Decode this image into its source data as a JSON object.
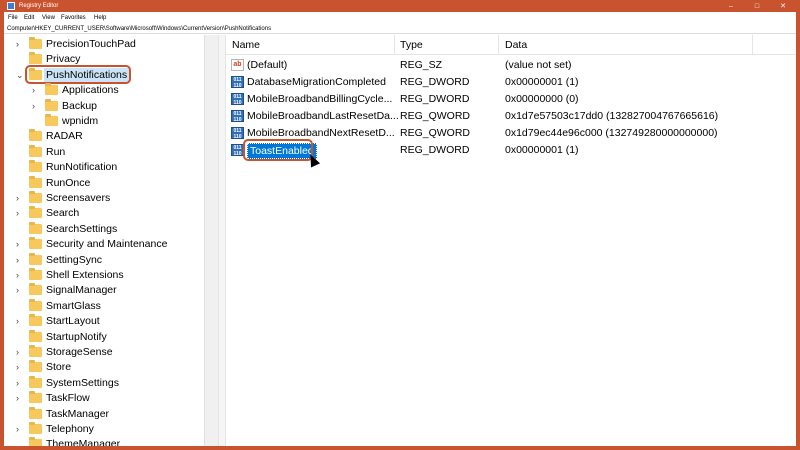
{
  "window": {
    "title": "Registry Editor",
    "controls": {
      "minimize": "–",
      "maximize": "□",
      "close": "✕"
    }
  },
  "menu": [
    "File",
    "Edit",
    "View",
    "Favorites",
    "Help"
  ],
  "address": "Computer\\HKEY_CURRENT_USER\\Software\\Microsoft\\Windows\\CurrentVersion\\PushNotifications",
  "tree": [
    {
      "label": "PrecisionTouchPad",
      "expandable": true,
      "indent": 0
    },
    {
      "label": "Privacy",
      "expandable": false,
      "indent": 0
    },
    {
      "label": "PushNotifications",
      "expandable": true,
      "expanded": true,
      "indent": 0,
      "selected": true
    },
    {
      "label": "Applications",
      "expandable": true,
      "indent": 1
    },
    {
      "label": "Backup",
      "expandable": true,
      "indent": 1
    },
    {
      "label": "wpnidm",
      "expandable": false,
      "indent": 1
    },
    {
      "label": "RADAR",
      "expandable": false,
      "indent": 0
    },
    {
      "label": "Run",
      "expandable": false,
      "indent": 0
    },
    {
      "label": "RunNotification",
      "expandable": false,
      "indent": 0
    },
    {
      "label": "RunOnce",
      "expandable": false,
      "indent": 0
    },
    {
      "label": "Screensavers",
      "expandable": true,
      "indent": 0
    },
    {
      "label": "Search",
      "expandable": true,
      "indent": 0
    },
    {
      "label": "SearchSettings",
      "expandable": false,
      "indent": 0
    },
    {
      "label": "Security and Maintenance",
      "expandable": true,
      "indent": 0
    },
    {
      "label": "SettingSync",
      "expandable": true,
      "indent": 0
    },
    {
      "label": "Shell Extensions",
      "expandable": true,
      "indent": 0
    },
    {
      "label": "SignalManager",
      "expandable": true,
      "indent": 0
    },
    {
      "label": "SmartGlass",
      "expandable": false,
      "indent": 0
    },
    {
      "label": "StartLayout",
      "expandable": true,
      "indent": 0
    },
    {
      "label": "StartupNotify",
      "expandable": false,
      "indent": 0
    },
    {
      "label": "StorageSense",
      "expandable": true,
      "indent": 0
    },
    {
      "label": "Store",
      "expandable": true,
      "indent": 0
    },
    {
      "label": "SystemSettings",
      "expandable": true,
      "indent": 0
    },
    {
      "label": "TaskFlow",
      "expandable": true,
      "indent": 0
    },
    {
      "label": "TaskManager",
      "expandable": false,
      "indent": 0
    },
    {
      "label": "Telephony",
      "expandable": true,
      "indent": 0
    },
    {
      "label": "ThemeManager",
      "expandable": false,
      "indent": 0
    }
  ],
  "list": {
    "headers": {
      "name": "Name",
      "type": "Type",
      "data": "Data"
    },
    "rows": [
      {
        "name": "(Default)",
        "type": "REG_SZ",
        "data": "(value not set)",
        "icon": "string-value-icon"
      },
      {
        "name": "DatabaseMigrationCompleted",
        "type": "REG_DWORD",
        "data": "0x00000001 (1)",
        "icon": "binary-value-icon"
      },
      {
        "name": "MobileBroadbandBillingCycle...",
        "type": "REG_DWORD",
        "data": "0x00000000 (0)",
        "icon": "binary-value-icon"
      },
      {
        "name": "MobileBroadbandLastResetDa...",
        "type": "REG_QWORD",
        "data": "0x1d7e57503c17dd0 (132827004767665616)",
        "icon": "binary-value-icon"
      },
      {
        "name": "MobileBroadbandNextResetD...",
        "type": "REG_QWORD",
        "data": "0x1d79ec44e96c000 (132749280000000000)",
        "icon": "binary-value-icon"
      },
      {
        "name": "ToastEnabled",
        "type": "REG_DWORD",
        "data": "0x00000001 (1)",
        "icon": "binary-value-icon",
        "selected": true
      }
    ]
  },
  "icon_glyphs": {
    "sz": "ab",
    "dw": "011 110"
  },
  "colors": {
    "accent": "#c9532e",
    "selection": "#0078d7",
    "folder": "#f7c95c"
  }
}
